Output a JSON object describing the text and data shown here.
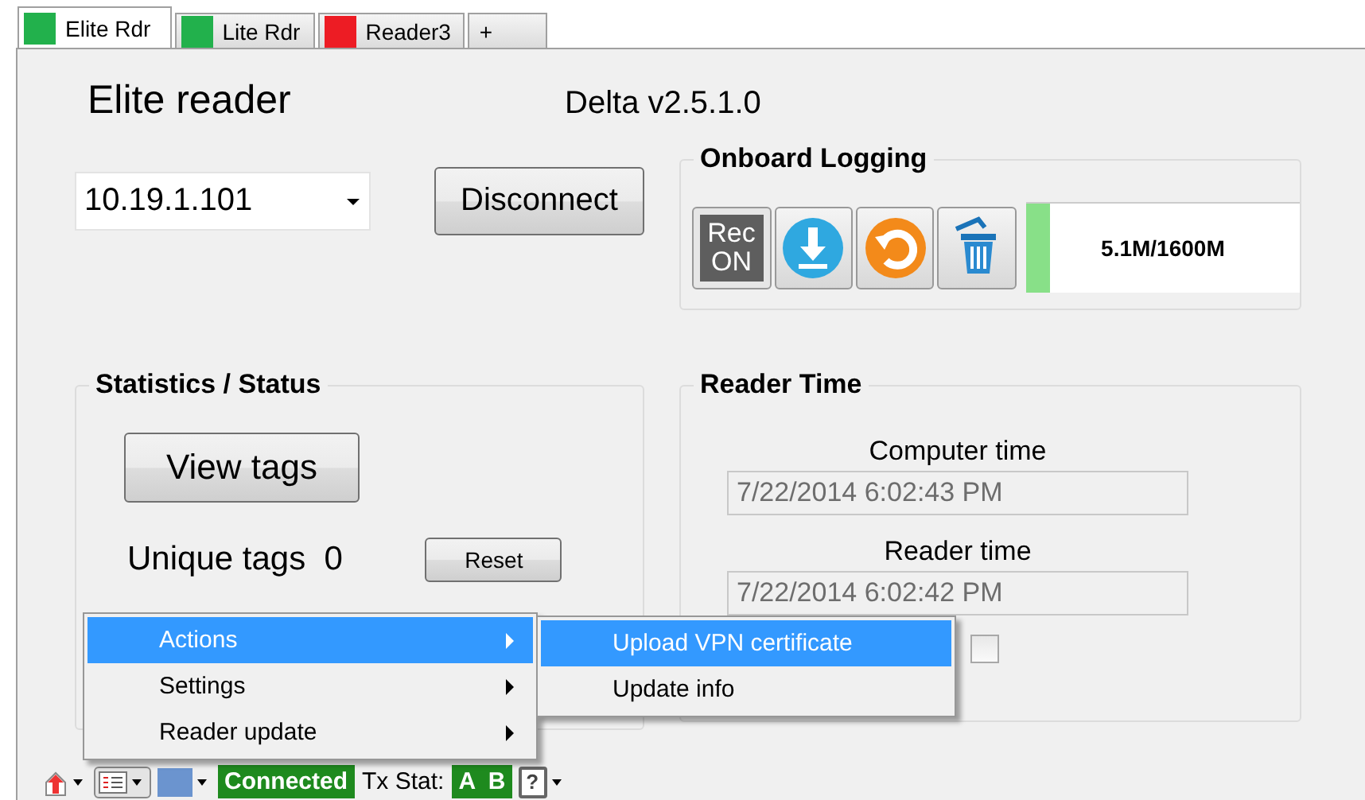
{
  "tabs": [
    {
      "label": "Elite Rdr",
      "color": "#22b14c",
      "selected": true
    },
    {
      "label": "Lite Rdr",
      "color": "#22b14c",
      "selected": false
    },
    {
      "label": "Reader3",
      "color": "#ed1c24",
      "selected": false
    },
    {
      "label": "+",
      "selected": false
    }
  ],
  "header": {
    "reader_name": "Elite reader",
    "version": "Delta v2.5.1.0"
  },
  "connection": {
    "address": "10.19.1.101",
    "button": "Disconnect"
  },
  "onboard_logging": {
    "title": "Onboard Logging",
    "rec_button": "Rec ON",
    "usage": {
      "level": 0.09,
      "reading": "5.1M/1600M"
    }
  },
  "statistics": {
    "title": "Statistics / Status",
    "view_button": "View tags",
    "unique_label": "Unique tags",
    "unique_count": "0",
    "reset_button": "Reset"
  },
  "reader_time": {
    "title": "Reader Time",
    "computer_label": "Computer time",
    "computer_value": "7/22/2014 6:02:43 PM",
    "reader_label": "Reader time",
    "reader_value": "7/22/2014 6:02:42 PM",
    "checkbox": {
      "checked": false
    }
  },
  "context_menu": {
    "items": [
      {
        "label": "Actions",
        "selected": true,
        "submenu": true
      },
      {
        "label": "Settings",
        "selected": false,
        "submenu": true
      },
      {
        "label": "Reader update",
        "selected": false,
        "submenu": true
      }
    ]
  },
  "submenu": {
    "items": [
      {
        "label": "Upload VPN certificate",
        "selected": true
      },
      {
        "label": "Update info",
        "selected": false
      }
    ]
  },
  "status_bar": {
    "connection": "Connected",
    "tx_label": "Tx Stat:",
    "tx_channels": [
      "A",
      "B"
    ],
    "help": "?"
  }
}
